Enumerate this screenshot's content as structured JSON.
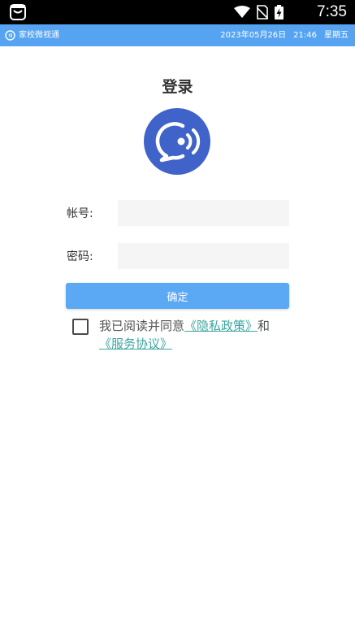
{
  "status_bar": {
    "time": "7:35",
    "icons": [
      "app-icon",
      "wifi-icon",
      "no-sim-icon",
      "battery-charging-icon"
    ]
  },
  "app_bar": {
    "app_name": "家校微视通",
    "date": "2023年05月26日",
    "time": "21:46",
    "weekday": "星期五"
  },
  "login": {
    "title": "登录",
    "account_label": "帐号:",
    "account_value": "",
    "password_label": "密码:",
    "password_value": "",
    "confirm_label": "确定"
  },
  "agreement": {
    "checked": false,
    "prefix": "我已阅读并同意",
    "privacy_link": "《隐私政策》",
    "conjunction": "和",
    "service_link": "《服务协议》"
  },
  "colors": {
    "app_bar": "#56a3f2",
    "button": "#5ba8f5",
    "logo": "#3f63c8",
    "link": "#3aa6a0"
  }
}
